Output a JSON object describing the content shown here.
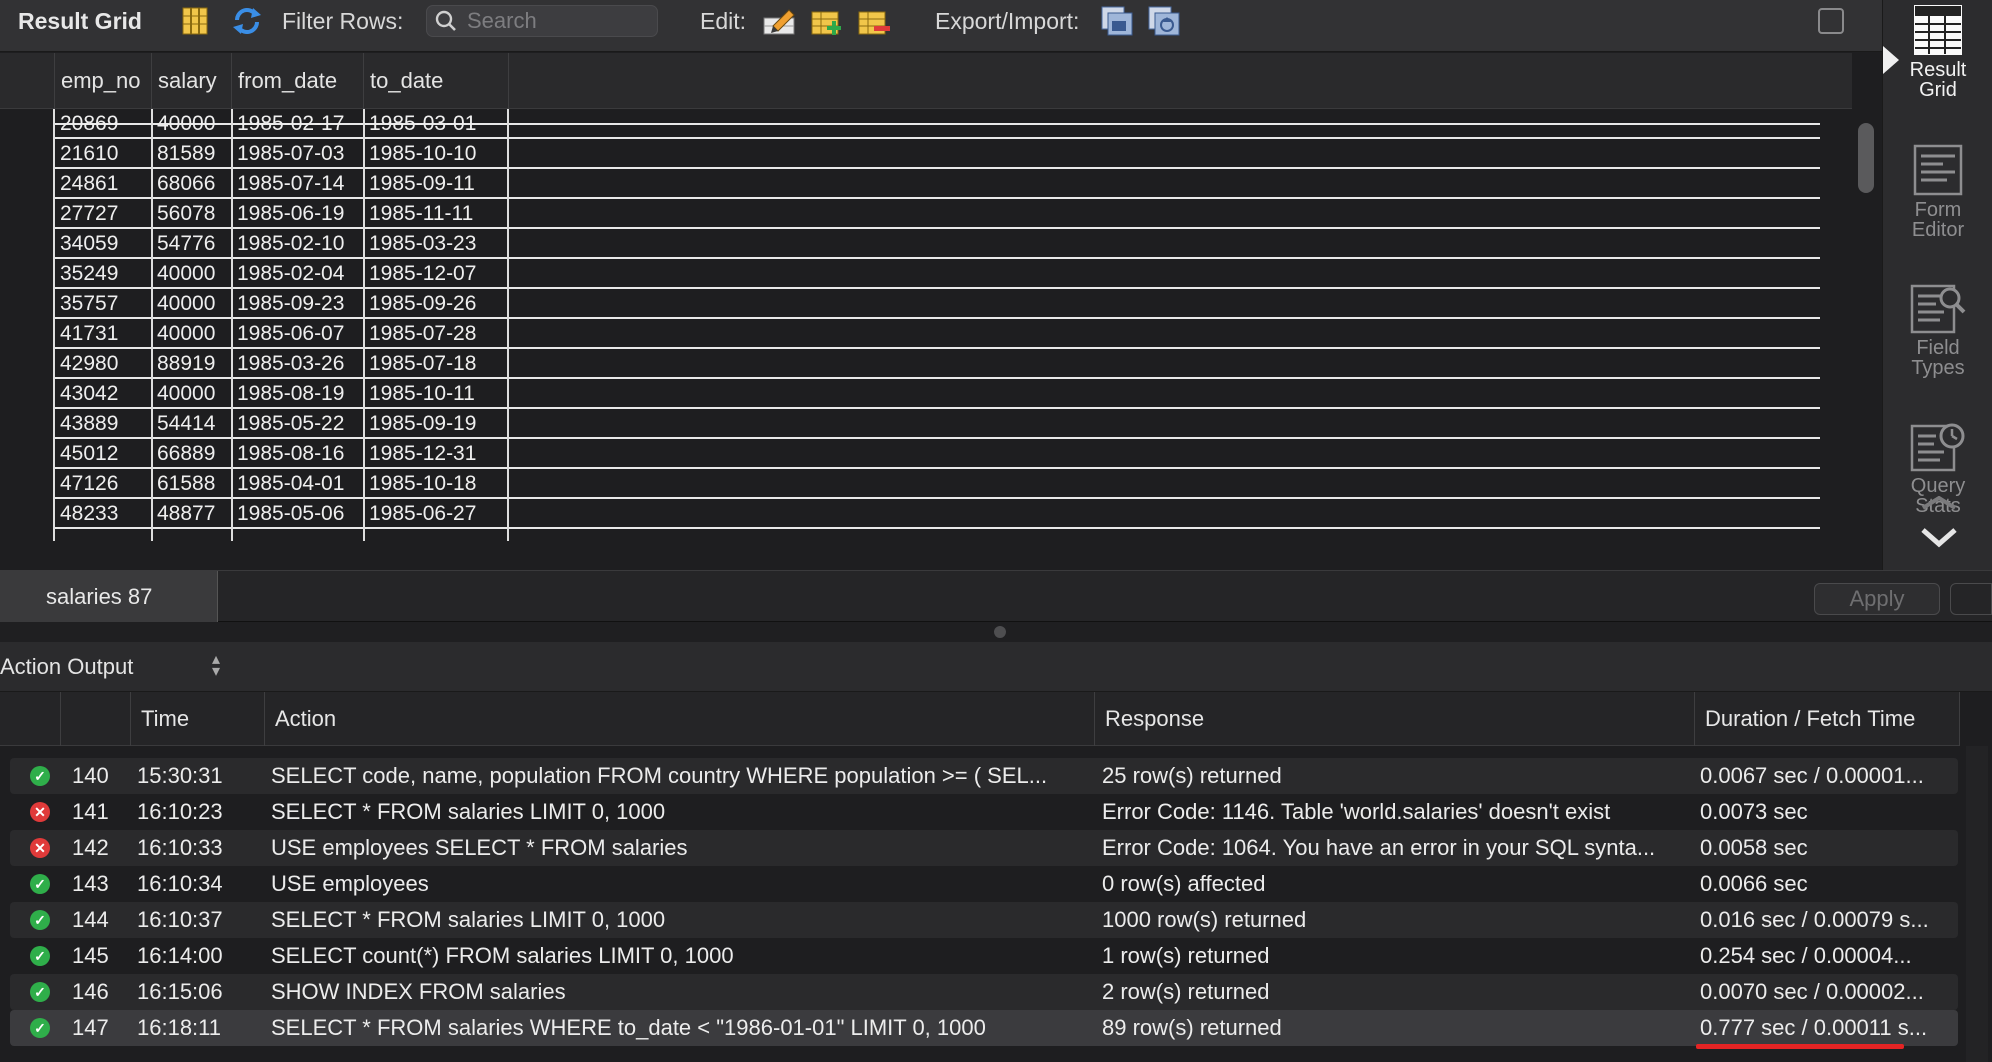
{
  "toolbar": {
    "title": "Result Grid",
    "filter_label": "Filter Rows:",
    "search_placeholder": "Search",
    "edit_label": "Edit:",
    "export_label": "Export/Import:"
  },
  "side_panel": {
    "items": [
      {
        "label1": "Result",
        "label2": "Grid",
        "icon": "result-grid-icon",
        "active": true
      },
      {
        "label1": "Form",
        "label2": "Editor",
        "icon": "form-editor-icon",
        "active": false
      },
      {
        "label1": "Field",
        "label2": "Types",
        "icon": "field-types-icon",
        "active": false
      },
      {
        "label1": "Query",
        "label2": "Stats",
        "icon": "query-stats-icon",
        "active": false
      }
    ]
  },
  "grid": {
    "columns": [
      "emp_no",
      "salary",
      "from_date",
      "to_date"
    ],
    "rows": [
      [
        "20869",
        "40000",
        "1985-02-17",
        "1985-03-01"
      ],
      [
        "21610",
        "81589",
        "1985-07-03",
        "1985-10-10"
      ],
      [
        "24861",
        "68066",
        "1985-07-14",
        "1985-09-11"
      ],
      [
        "27727",
        "56078",
        "1985-06-19",
        "1985-11-11"
      ],
      [
        "34059",
        "54776",
        "1985-02-10",
        "1985-03-23"
      ],
      [
        "35249",
        "40000",
        "1985-02-04",
        "1985-12-07"
      ],
      [
        "35757",
        "40000",
        "1985-09-23",
        "1985-09-26"
      ],
      [
        "41731",
        "40000",
        "1985-06-07",
        "1985-07-28"
      ],
      [
        "42980",
        "88919",
        "1985-03-26",
        "1985-07-18"
      ],
      [
        "43042",
        "40000",
        "1985-08-19",
        "1985-10-11"
      ],
      [
        "43889",
        "54414",
        "1985-05-22",
        "1985-09-19"
      ],
      [
        "45012",
        "66889",
        "1985-08-16",
        "1985-12-31"
      ],
      [
        "47126",
        "61588",
        "1985-04-01",
        "1985-10-18"
      ],
      [
        "48233",
        "48877",
        "1985-05-06",
        "1985-06-27"
      ]
    ]
  },
  "tabs": {
    "active_tab": "salaries 87",
    "apply_label": "Apply"
  },
  "output": {
    "title": "Action Output",
    "columns": [
      "Time",
      "Action",
      "Response",
      "Duration / Fetch Time"
    ],
    "rows": [
      {
        "status": "ok",
        "num": "140",
        "time": "15:30:31",
        "action": "SELECT code, name, population FROM country WHERE population >= (  SEL...",
        "response": "25 row(s) returned",
        "duration": "0.0067 sec / 0.00001..."
      },
      {
        "status": "err",
        "num": "141",
        "time": "16:10:23",
        "action": "SELECT * FROM salaries LIMIT 0, 1000",
        "response": "Error Code: 1146. Table 'world.salaries' doesn't exist",
        "duration": "0.0073 sec"
      },
      {
        "status": "err",
        "num": "142",
        "time": "16:10:33",
        "action": "USE employees  SELECT * FROM salaries",
        "response": "Error Code: 1064. You have an error in your SQL synta...",
        "duration": "0.0058 sec"
      },
      {
        "status": "ok",
        "num": "143",
        "time": "16:10:34",
        "action": "USE employees",
        "response": "0 row(s) affected",
        "duration": "0.0066 sec"
      },
      {
        "status": "ok",
        "num": "144",
        "time": "16:10:37",
        "action": "SELECT * FROM salaries LIMIT 0, 1000",
        "response": "1000 row(s) returned",
        "duration": "0.016 sec / 0.00079 s..."
      },
      {
        "status": "ok",
        "num": "145",
        "time": "16:14:00",
        "action": "SELECT count(*) FROM salaries LIMIT 0, 1000",
        "response": "1 row(s) returned",
        "duration": "0.254 sec / 0.00004..."
      },
      {
        "status": "ok",
        "num": "146",
        "time": "16:15:06",
        "action": "SHOW INDEX FROM salaries",
        "response": "2 row(s) returned",
        "duration": "0.0070 sec / 0.00002..."
      },
      {
        "status": "ok",
        "num": "147",
        "time": "16:18:11",
        "action": "SELECT * FROM salaries WHERE to_date < \"1986-01-01\" LIMIT 0, 1000",
        "response": "89 row(s) returned",
        "duration": "0.777 sec / 0.00011 s..."
      }
    ]
  },
  "colors": {
    "ok": "#2fae4a",
    "error": "#e03a3a",
    "highlight_underline": "#e52424"
  }
}
